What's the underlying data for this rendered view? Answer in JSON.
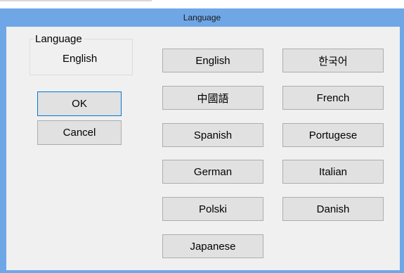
{
  "window": {
    "title": "Language"
  },
  "group": {
    "label": "Language",
    "value": "English"
  },
  "dialog": {
    "ok": "OK",
    "cancel": "Cancel"
  },
  "languages": [
    "English",
    "한국어",
    "中國語",
    "French",
    "Spanish",
    "Portugese",
    "German",
    "Italian",
    "Polski",
    "Danish",
    "Japanese"
  ]
}
